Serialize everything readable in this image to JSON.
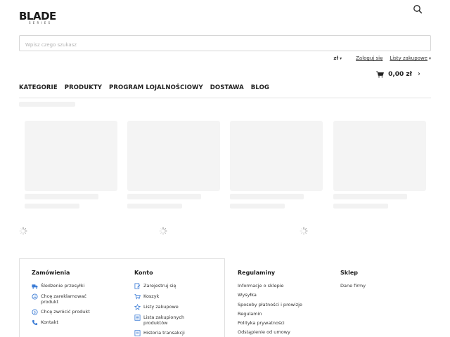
{
  "header": {
    "logo_text": "BLADE",
    "logo_sub": "SERIES",
    "search": {
      "placeholder": "Wpisz czego szukasz",
      "value": ""
    },
    "currency": "zł",
    "login_label": "Zaloguj się",
    "shopping_lists_label": "Listy zakupowe",
    "cart_total": "0,00 zł"
  },
  "nav": {
    "items": [
      {
        "label": "KATEGORIE"
      },
      {
        "label": "PRODUKTY"
      },
      {
        "label": "PROGRAM LOJALNOŚCIOWY"
      },
      {
        "label": "DOSTAWA"
      },
      {
        "label": "BLOG"
      }
    ]
  },
  "footer": {
    "orders": {
      "title": "Zamówienia",
      "items": [
        {
          "label": "Śledzenie przesyłki",
          "icon": "truck-icon"
        },
        {
          "label": "Chcę zareklamować produkt",
          "icon": "complaint-icon"
        },
        {
          "label": "Chcę zwrócić produkt",
          "icon": "return-icon"
        },
        {
          "label": "Kontakt",
          "icon": "phone-icon"
        }
      ]
    },
    "account": {
      "title": "Konto",
      "items": [
        {
          "label": "Zarejestruj się",
          "icon": "register-icon"
        },
        {
          "label": "Koszyk",
          "icon": "cart-icon"
        },
        {
          "label": "Listy zakupowe",
          "icon": "star-icon"
        },
        {
          "label": "Lista zakupionych produktów",
          "icon": "list-icon"
        },
        {
          "label": "Historia transakcji",
          "icon": "history-icon"
        }
      ]
    },
    "regulations": {
      "title": "Regulaminy",
      "items": [
        {
          "label": "Informacje o sklepie"
        },
        {
          "label": "Wysyłka"
        },
        {
          "label": "Sposoby płatności i prowizje"
        },
        {
          "label": "Regulamin"
        },
        {
          "label": "Polityka prywatności"
        },
        {
          "label": "Odstąpienie od umowy"
        }
      ]
    },
    "shop": {
      "title": "Sklep",
      "items": [
        {
          "label": "Dane firmy"
        }
      ]
    }
  },
  "colors": {
    "accent": "#3a7bd5",
    "text": "#222222",
    "skeleton": "#f3f3f3",
    "border": "#e0e0e0"
  }
}
